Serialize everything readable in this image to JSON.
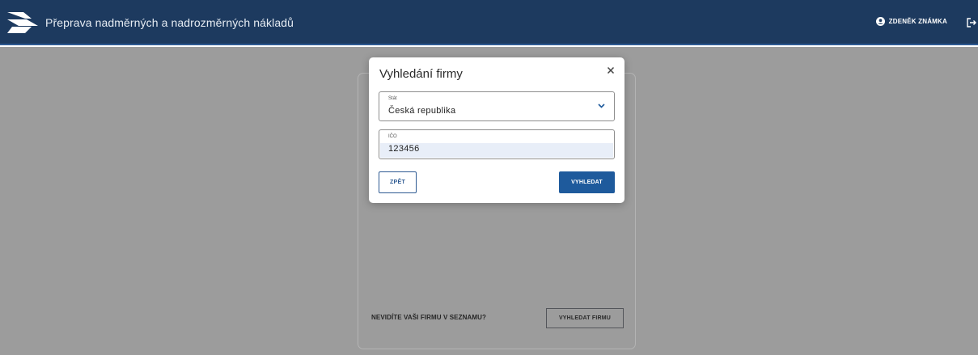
{
  "header": {
    "app_title": "Přeprava nadměrných a nadrozměrných nákladů",
    "user_name": "ZDENĚK ZNÁMKA",
    "logo_icon": "truck-logo-icon",
    "user_icon": "account-circle-icon",
    "logout_icon": "logout-icon"
  },
  "background_card": {
    "question": "NEVIDÍTE VAŠI FIRMU V SEZNAMU?",
    "button_label": "VYHLEDAT FIRMU"
  },
  "modal": {
    "title": "Vyhledání firmy",
    "close_icon": "close-icon",
    "state_field": {
      "label": "Stát",
      "value": "Česká republika"
    },
    "ico_field": {
      "label": "IČO",
      "value": "123456"
    },
    "back_button": "ZPĚT",
    "search_button": "VYHLEDAT"
  },
  "colors": {
    "header_bg": "#1d3a5f",
    "primary": "#1e5a9c",
    "overlay": "#9c9c9c"
  }
}
